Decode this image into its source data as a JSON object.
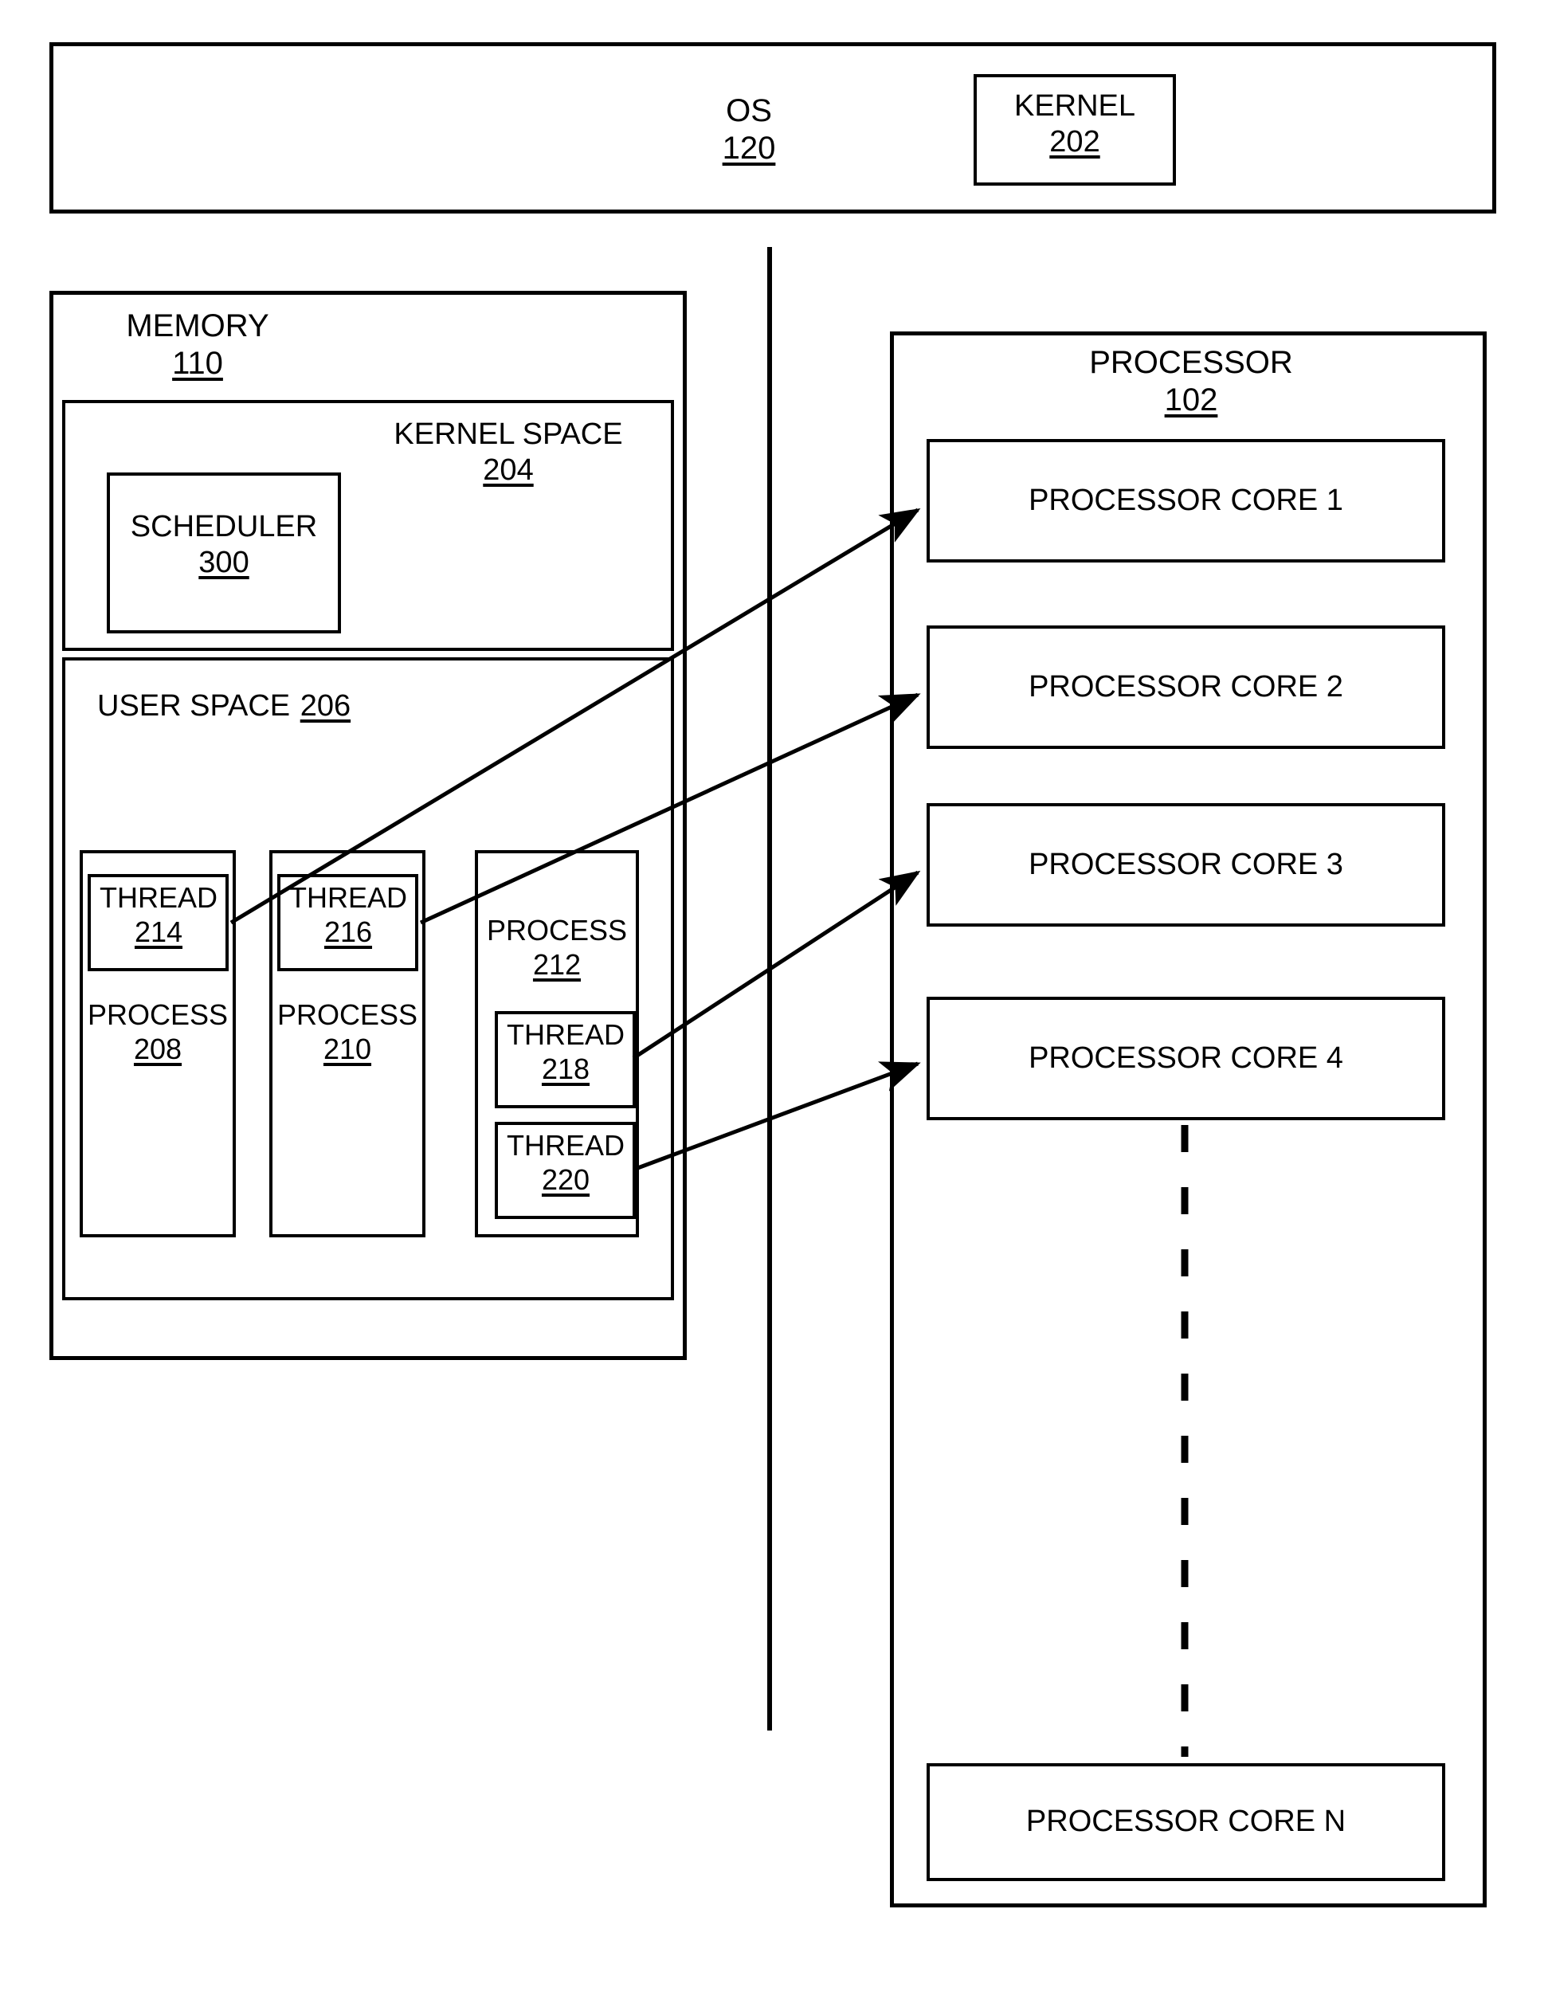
{
  "figure": {
    "os_block": {
      "title": "OS",
      "ref": "120"
    },
    "kernel_block": {
      "title": "KERNEL",
      "ref": "202"
    },
    "memory_block": {
      "title": "MEMORY",
      "ref": "110"
    },
    "kernel_space_block": {
      "title": "KERNEL SPACE",
      "ref": "204"
    },
    "scheduler_block": {
      "title": "SCHEDULER",
      "ref": "300"
    },
    "user_space_block": {
      "title": "USER SPACE",
      "ref": "206"
    },
    "processes": [
      {
        "title": "PROCESS",
        "ref": "208"
      },
      {
        "title": "PROCESS",
        "ref": "210"
      },
      {
        "title": "PROCESS",
        "ref": "212"
      }
    ],
    "threads": [
      {
        "title": "THREAD",
        "ref": "214"
      },
      {
        "title": "THREAD",
        "ref": "216"
      },
      {
        "title": "THREAD",
        "ref": "218"
      },
      {
        "title": "THREAD",
        "ref": "220"
      }
    ],
    "processor_block": {
      "title": "PROCESSOR",
      "ref": "102"
    },
    "cores": [
      {
        "label": "PROCESSOR CORE 1"
      },
      {
        "label": "PROCESSOR CORE 2"
      },
      {
        "label": "PROCESSOR CORE 3"
      },
      {
        "label": "PROCESSOR CORE 4"
      },
      {
        "label": "PROCESSOR CORE N"
      }
    ],
    "colors": {
      "ink": "#000000",
      "paper": "#ffffff"
    }
  }
}
